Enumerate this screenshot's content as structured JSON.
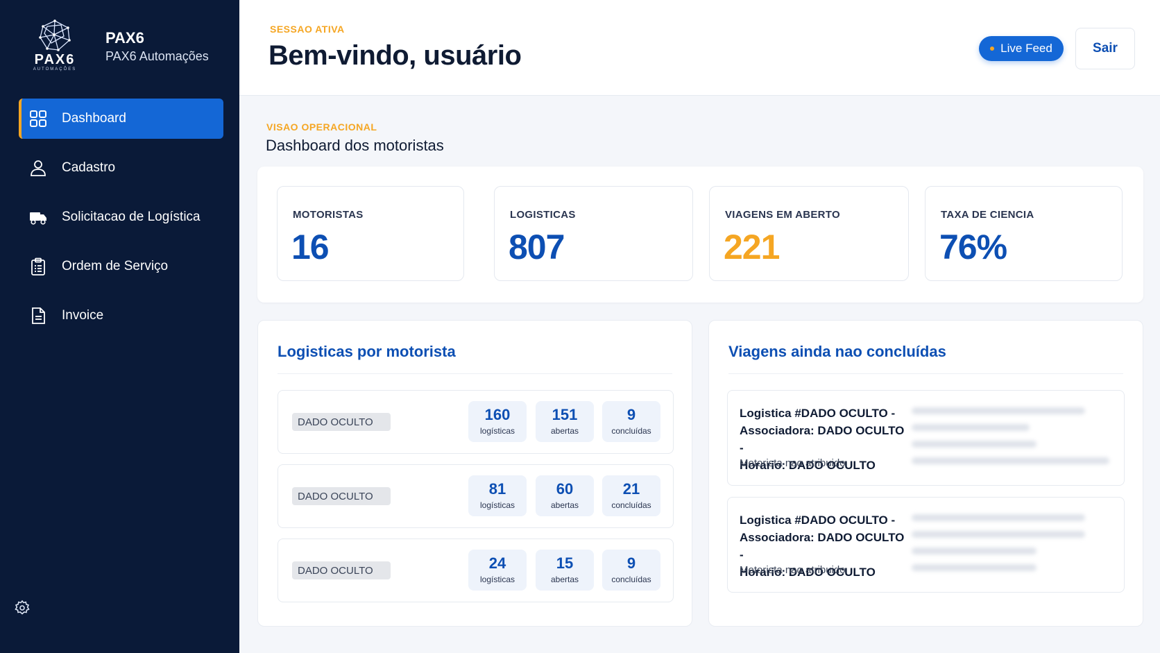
{
  "brand": {
    "logo_text": "PAX6",
    "logo_sub": "AUTOMAÇÕES",
    "name": "PAX6",
    "subtitle": "PAX6 Automações"
  },
  "nav": [
    {
      "label": "Dashboard",
      "icon": "grid-icon",
      "active": true
    },
    {
      "label": "Cadastro",
      "icon": "user-icon"
    },
    {
      "label": "Solicitacao de Logística",
      "icon": "truck-icon"
    },
    {
      "label": "Ordem de Serviço",
      "icon": "clipboard-icon"
    },
    {
      "label": "Invoice",
      "icon": "document-icon"
    }
  ],
  "header": {
    "eyebrow": "SESSAO ATIVA",
    "title": "Bem-vindo, usuário",
    "live_label": "Live Feed",
    "exit_label": "Sair"
  },
  "section": {
    "eyebrow": "VISAO OPERACIONAL",
    "title": "Dashboard dos motoristas"
  },
  "stats": [
    {
      "label": "MOTORISTAS",
      "value": "16",
      "color": "#0d4fb3"
    },
    {
      "label": "LOGISTICAS",
      "value": "807",
      "color": "#0d4fb3"
    },
    {
      "label": "VIAGENS EM ABERTO",
      "value": "221",
      "color": "#f5a623"
    },
    {
      "label": "TAXA DE CIENCIA",
      "value": "76%",
      "color": "#0d4fb3"
    }
  ],
  "drivers_panel": {
    "title": "Logisticas por motorista",
    "rows": [
      {
        "name": "DADO OCULTO",
        "logisticas": "160",
        "abertas": "151",
        "concluidas": "9"
      },
      {
        "name": "DADO OCULTO",
        "logisticas": "81",
        "abertas": "60",
        "concluidas": "21"
      },
      {
        "name": "DADO OCULTO",
        "logisticas": "24",
        "abertas": "15",
        "concluidas": "9"
      }
    ],
    "labels": {
      "logisticas": "logísticas",
      "abertas": "abertas",
      "concluidas": "concluídas"
    }
  },
  "trips_panel": {
    "title": "Viagens ainda nao concluídas",
    "trips": [
      {
        "line1": "Logistica #DADO OCULTO -",
        "line2": "Associadora: DADO OCULTO -",
        "line3": "Horario: DADO OCULTO",
        "status": "Motorista nao atribuido"
      },
      {
        "line1": "Logistica #DADO OCULTO -",
        "line2": "Associadora: DADO OCULTO -",
        "line3": "Horario: DADO OCULTO",
        "status": "Motorista nao atribuido"
      }
    ]
  },
  "colors": {
    "sidebar": "#0a1a38",
    "accent": "#1467d6",
    "highlight": "#f5a623"
  }
}
